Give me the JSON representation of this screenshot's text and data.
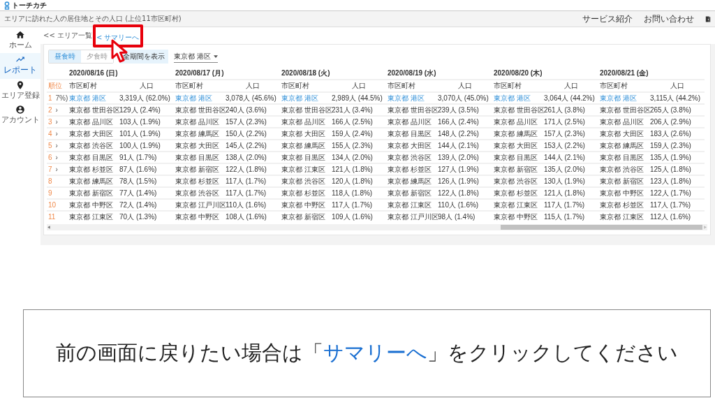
{
  "app": {
    "logo": "トーチカチ"
  },
  "header": {
    "title": "エリアに訪れた人の居住地とその人口 (上位11市区町村)",
    "links": [
      "サービス紹介",
      "お問い合わせ"
    ]
  },
  "sidebar": {
    "items": [
      {
        "label": "ホーム",
        "selected": false
      },
      {
        "label": "レポート",
        "selected": true
      },
      {
        "label": "エリア登録",
        "selected": false
      },
      {
        "label": "アカウント",
        "selected": false
      }
    ]
  },
  "breadcrumb": {
    "back": "<< エリア一覧",
    "summary": "< サマリーへ",
    "highlighted": true
  },
  "toolbar": {
    "toggles": [
      {
        "label": "昼食時",
        "selected": true
      },
      {
        "label": "夕食時",
        "selected": false
      }
    ],
    "show_all": "全期間を表示",
    "area_select": "東京都 港区"
  },
  "table": {
    "rank_header": "順位",
    "ranks": [
      {
        "rank": "1",
        "note": "7%)"
      },
      {
        "rank": "2",
        "note": "›"
      },
      {
        "rank": "3",
        "note": "›"
      },
      {
        "rank": "4",
        "note": "›"
      },
      {
        "rank": "5",
        "note": "›"
      },
      {
        "rank": "6",
        "note": "›"
      },
      {
        "rank": "7",
        "note": "›"
      },
      {
        "rank": "8"
      },
      {
        "rank": "9"
      },
      {
        "rank": "10"
      },
      {
        "rank": "11"
      }
    ],
    "days": [
      {
        "date": "2020/08/16 (日)",
        "area_header": "市区町村",
        "population_header": "人口",
        "entries": [
          {
            "area": "東京都 港区",
            "population": "3,319人 (62.0%)",
            "link": true
          },
          {
            "area": "東京都 世田谷区",
            "population": "129人 (2.4%)",
            "link": false
          },
          {
            "area": "東京都 品川区",
            "population": "103人 (1.9%)",
            "link": false
          },
          {
            "area": "東京都 大田区",
            "population": "101人 (1.9%)",
            "link": false
          },
          {
            "area": "東京都 渋谷区",
            "population": "100人 (1.9%)",
            "link": false
          },
          {
            "area": "東京都 目黒区",
            "population": "91人 (1.7%)",
            "link": false
          },
          {
            "area": "東京都 杉並区",
            "population": "87人 (1.6%)",
            "link": false
          },
          {
            "area": "東京都 練馬区",
            "population": "78人 (1.5%)",
            "link": false
          },
          {
            "area": "東京都 新宿区",
            "population": "77人 (1.4%)",
            "link": false
          },
          {
            "area": "東京都 中野区",
            "population": "72人 (1.4%)",
            "link": false
          },
          {
            "area": "東京都 江東区",
            "population": "70人 (1.3%)",
            "link": false
          }
        ]
      },
      {
        "date": "2020/08/17 (月)",
        "area_header": "市区町村",
        "population_header": "人口",
        "entries": [
          {
            "area": "東京都 港区",
            "population": "3,078人 (45.6%)",
            "link": true
          },
          {
            "area": "東京都 世田谷区",
            "population": "240人 (3.6%)",
            "link": false
          },
          {
            "area": "東京都 品川区",
            "population": "157人 (2.3%)",
            "link": false
          },
          {
            "area": "東京都 練馬区",
            "population": "150人 (2.2%)",
            "link": false
          },
          {
            "area": "東京都 大田区",
            "population": "145人 (2.2%)",
            "link": false
          },
          {
            "area": "東京都 目黒区",
            "population": "138人 (2.0%)",
            "link": false
          },
          {
            "area": "東京都 新宿区",
            "population": "122人 (1.8%)",
            "link": false
          },
          {
            "area": "東京都 杉並区",
            "population": "117人 (1.7%)",
            "link": false
          },
          {
            "area": "東京都 渋谷区",
            "population": "117人 (1.7%)",
            "link": false
          },
          {
            "area": "東京都 江戸川区",
            "population": "110人 (1.6%)",
            "link": false
          },
          {
            "area": "東京都 中野区",
            "population": "108人 (1.6%)",
            "link": false
          }
        ]
      },
      {
        "date": "2020/08/18 (火)",
        "area_header": "市区町村",
        "population_header": "人口",
        "entries": [
          {
            "area": "東京都 港区",
            "population": "2,989人 (44.5%)",
            "link": true
          },
          {
            "area": "東京都 世田谷区",
            "population": "231人 (3.4%)",
            "link": false
          },
          {
            "area": "東京都 品川区",
            "population": "166人 (2.5%)",
            "link": false
          },
          {
            "area": "東京都 大田区",
            "population": "159人 (2.4%)",
            "link": false
          },
          {
            "area": "東京都 練馬区",
            "population": "155人 (2.3%)",
            "link": false
          },
          {
            "area": "東京都 目黒区",
            "population": "134人 (2.0%)",
            "link": false
          },
          {
            "area": "東京都 江東区",
            "population": "121人 (1.8%)",
            "link": false
          },
          {
            "area": "東京都 渋谷区",
            "population": "120人 (1.8%)",
            "link": false
          },
          {
            "area": "東京都 杉並区",
            "population": "118人 (1.8%)",
            "link": false
          },
          {
            "area": "東京都 中野区",
            "population": "117人 (1.7%)",
            "link": false
          },
          {
            "area": "東京都 新宿区",
            "population": "109人 (1.6%)",
            "link": false
          }
        ]
      },
      {
        "date": "2020/08/19 (水)",
        "area_header": "市区町村",
        "population_header": "人口",
        "entries": [
          {
            "area": "東京都 港区",
            "population": "3,070人 (45.0%)",
            "link": true
          },
          {
            "area": "東京都 世田谷区",
            "population": "239人 (3.5%)",
            "link": false
          },
          {
            "area": "東京都 品川区",
            "population": "166人 (2.4%)",
            "link": false
          },
          {
            "area": "東京都 目黒区",
            "population": "148人 (2.2%)",
            "link": false
          },
          {
            "area": "東京都 大田区",
            "population": "144人 (2.1%)",
            "link": false
          },
          {
            "area": "東京都 渋谷区",
            "population": "139人 (2.0%)",
            "link": false
          },
          {
            "area": "東京都 杉並区",
            "population": "127人 (1.9%)",
            "link": false
          },
          {
            "area": "東京都 練馬区",
            "population": "126人 (1.9%)",
            "link": false
          },
          {
            "area": "東京都 新宿区",
            "population": "122人 (1.8%)",
            "link": false
          },
          {
            "area": "東京都 江東区",
            "population": "110人 (1.6%)",
            "link": false
          },
          {
            "area": "東京都 江戸川区",
            "population": "98人 (1.4%)",
            "link": false
          }
        ]
      },
      {
        "date": "2020/08/20 (木)",
        "area_header": "市区町村",
        "population_header": "人口",
        "entries": [
          {
            "area": "東京都 港区",
            "population": "3,064人 (44.2%)",
            "link": true
          },
          {
            "area": "東京都 世田谷区",
            "population": "261人 (3.8%)",
            "link": false
          },
          {
            "area": "東京都 品川区",
            "population": "171人 (2.5%)",
            "link": false
          },
          {
            "area": "東京都 練馬区",
            "population": "157人 (2.3%)",
            "link": false
          },
          {
            "area": "東京都 大田区",
            "population": "153人 (2.2%)",
            "link": false
          },
          {
            "area": "東京都 目黒区",
            "population": "144人 (2.1%)",
            "link": false
          },
          {
            "area": "東京都 新宿区",
            "population": "135人 (2.0%)",
            "link": false
          },
          {
            "area": "東京都 渋谷区",
            "population": "130人 (1.9%)",
            "link": false
          },
          {
            "area": "東京都 杉並区",
            "population": "121人 (1.8%)",
            "link": false
          },
          {
            "area": "東京都 江東区",
            "population": "117人 (1.7%)",
            "link": false
          },
          {
            "area": "東京都 中野区",
            "population": "115人 (1.7%)",
            "link": false
          }
        ]
      },
      {
        "date": "2020/08/21 (金)",
        "area_header": "市区町村",
        "population_header": "人口",
        "entries": [
          {
            "area": "東京都 港区",
            "population": "3,115人 (44.2%)",
            "link": true
          },
          {
            "area": "東京都 世田谷区",
            "population": "265人 (3.8%)",
            "link": false
          },
          {
            "area": "東京都 品川区",
            "population": "206人 (2.9%)",
            "link": false
          },
          {
            "area": "東京都 大田区",
            "population": "183人 (2.6%)",
            "link": false
          },
          {
            "area": "東京都 練馬区",
            "population": "159人 (2.3%)",
            "link": false
          },
          {
            "area": "東京都 目黒区",
            "population": "135人 (1.9%)",
            "link": false
          },
          {
            "area": "東京都 渋谷区",
            "population": "125人 (1.8%)",
            "link": false
          },
          {
            "area": "東京都 新宿区",
            "population": "123人 (1.8%)",
            "link": false
          },
          {
            "area": "東京都 中野区",
            "population": "122人 (1.7%)",
            "link": false
          },
          {
            "area": "東京都 杉並区",
            "population": "117人 (1.7%)",
            "link": false
          },
          {
            "area": "東京都 江東区",
            "population": "112人 (1.6%)",
            "link": false
          }
        ]
      }
    ]
  },
  "caption": {
    "before": "前の画面に戻りたい場合は「",
    "link": "サマリーへ",
    "after": "」をクリックしてください"
  }
}
